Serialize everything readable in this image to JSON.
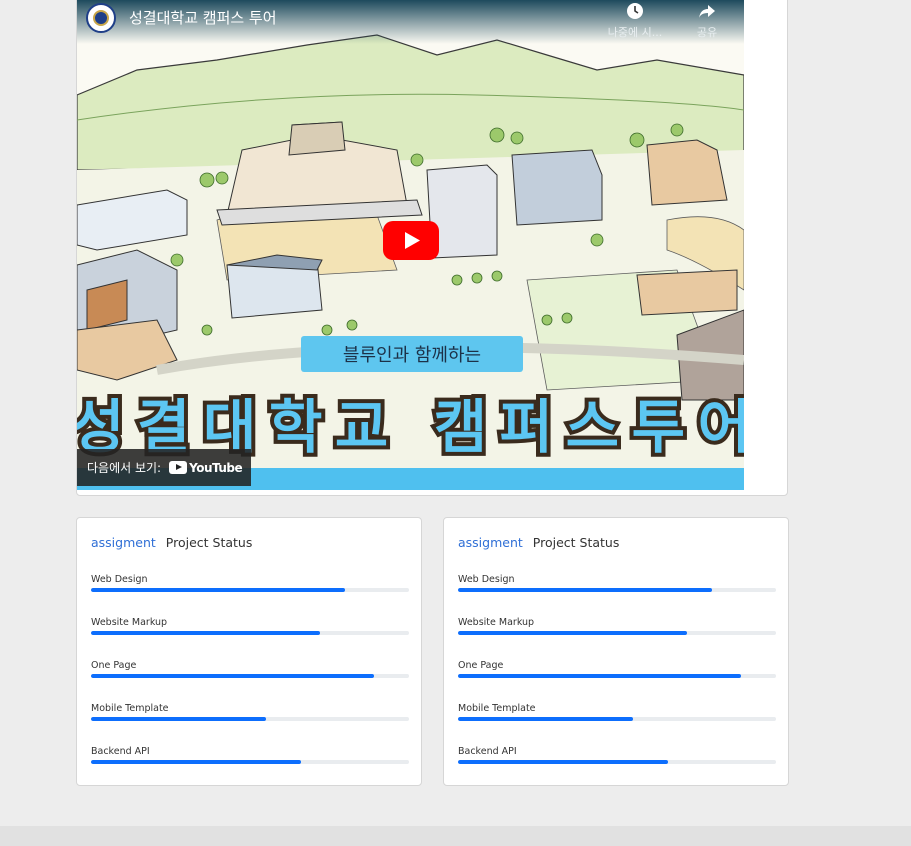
{
  "video": {
    "title": "성결대학교 캠퍼스 투어",
    "watch_later_label": "나중에 시...",
    "share_label": "공유",
    "banner_sub": "블루인과 함께하는",
    "banner_main": "성결대학교 캠퍼스투어",
    "watch_on_label": "다음에서 보기:",
    "youtube_label": "YouTube",
    "colors": {
      "accent_blue": "#4fc0ef",
      "play_red": "#ff0000"
    }
  },
  "cards": [
    {
      "accent": "assigment",
      "title": "Project Status",
      "items": [
        {
          "label": "Web Design",
          "progress": 80
        },
        {
          "label": "Website Markup",
          "progress": 72
        },
        {
          "label": "One Page",
          "progress": 89
        },
        {
          "label": "Mobile Template",
          "progress": 55
        },
        {
          "label": "Backend API",
          "progress": 66
        }
      ]
    },
    {
      "accent": "assigment",
      "title": "Project Status",
      "items": [
        {
          "label": "Web Design",
          "progress": 80
        },
        {
          "label": "Website Markup",
          "progress": 72
        },
        {
          "label": "One Page",
          "progress": 89
        },
        {
          "label": "Mobile Template",
          "progress": 55
        },
        {
          "label": "Backend API",
          "progress": 66
        }
      ]
    }
  ],
  "progress_color": "#0d6efd"
}
